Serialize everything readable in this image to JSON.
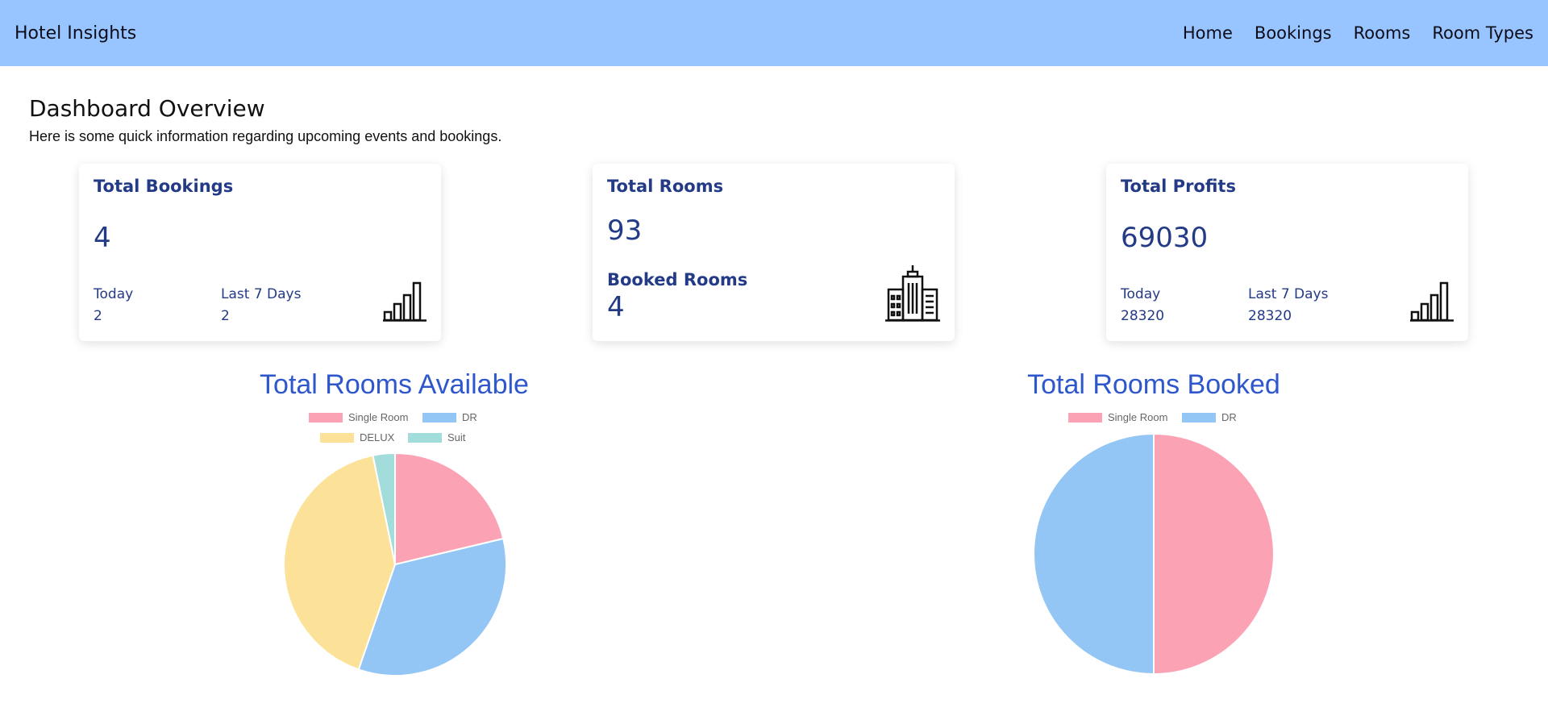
{
  "navbar": {
    "brand": "Hotel Insights",
    "links": [
      "Home",
      "Bookings",
      "Rooms",
      "Room Types"
    ]
  },
  "header": {
    "title": "Dashboard Overview",
    "subtitle": "Here is some quick information regarding upcoming events and bookings."
  },
  "cards": {
    "bookings": {
      "title": "Total Bookings",
      "value": "4",
      "today_label": "Today",
      "today_value": "2",
      "week_label": "Last 7 Days",
      "week_value": "2",
      "icon": "bar-chart-icon"
    },
    "rooms": {
      "title": "Total Rooms",
      "value": "93",
      "booked_label": "Booked Rooms",
      "booked_value": "4",
      "icon": "building-icon"
    },
    "profits": {
      "title": "Total Profits",
      "value": "69030",
      "today_label": "Today",
      "today_value": "28320",
      "week_label": "Last 7 Days",
      "week_value": "28320",
      "icon": "bar-chart-icon"
    }
  },
  "colors": {
    "navbar": "#98c5ff",
    "card_text": "#233a86",
    "chart_title": "#2f57cc",
    "slice_pink": "#fba3b5",
    "slice_blue": "#93c6f4",
    "slice_yellow": "#fce298",
    "slice_teal": "#a2dcdb"
  },
  "chart_data": [
    {
      "type": "pie",
      "title": "Total Rooms Available",
      "legend": "top",
      "categories": [
        "Single Room",
        "DR",
        "DELUX",
        "Suit"
      ],
      "values": [
        20,
        32,
        39,
        3
      ],
      "colors": [
        "#fba3b5",
        "#93c6f4",
        "#fce298",
        "#a2dcdb"
      ]
    },
    {
      "type": "pie",
      "title": "Total Rooms Booked",
      "legend": "top",
      "categories": [
        "Single Room",
        "DR"
      ],
      "values": [
        2,
        2
      ],
      "colors": [
        "#fba3b5",
        "#93c6f4"
      ]
    }
  ]
}
